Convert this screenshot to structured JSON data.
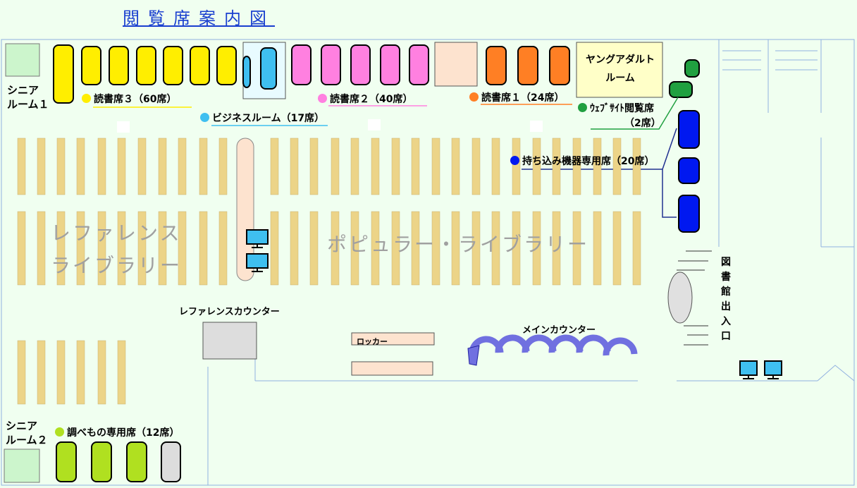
{
  "title": "閲覧席案内図",
  "areas": {
    "reference_library": [
      "レファレンス",
      "ライブラリー"
    ],
    "popular_library": "ポピュラー・ライブラリー",
    "young_adult_room": [
      "ヤングアダルト",
      "ルーム"
    ],
    "senior_room_1": [
      "シニア",
      "ルーム１"
    ],
    "senior_room_2": [
      "シニア",
      "ルーム２"
    ],
    "reference_counter": "レファレンスカウンター",
    "locker": "ロッカー",
    "main_counter": "メインカウンター",
    "entrance": "図書館出入口"
  },
  "legend": [
    {
      "key": "reading3",
      "label": "読書席３（60席）",
      "color": "#ffee00"
    },
    {
      "key": "reading2",
      "label": "読書席２（40席）",
      "color": "#ff80e0"
    },
    {
      "key": "reading1",
      "label": "読書席１（24席）",
      "color": "#ff7f24"
    },
    {
      "key": "business",
      "label": "ビジネスルーム（17席）",
      "color": "#3fbff0"
    },
    {
      "key": "website",
      "label": "ｳｪﾌﾞｻｲﾄ閲覧席",
      "label2": "（2席）",
      "color": "#20a040"
    },
    {
      "key": "device",
      "label": "持ち込み機器専用席（20席）",
      "color": "#0018f0"
    },
    {
      "key": "research",
      "label": "調べもの専用席（12席）",
      "color": "#b0e020"
    }
  ],
  "colors": {
    "background": "#f0fff0",
    "shelf": "#ecd488",
    "wall": "#90b0e0",
    "title": "#1a3fcf",
    "yellow": "#ffee00",
    "pink": "#ff80e0",
    "orange": "#ff7f24",
    "cyan": "#3fbff0",
    "green": "#20a040",
    "blue": "#0018f0",
    "lime": "#b0e020",
    "grey": "#dddddd"
  }
}
